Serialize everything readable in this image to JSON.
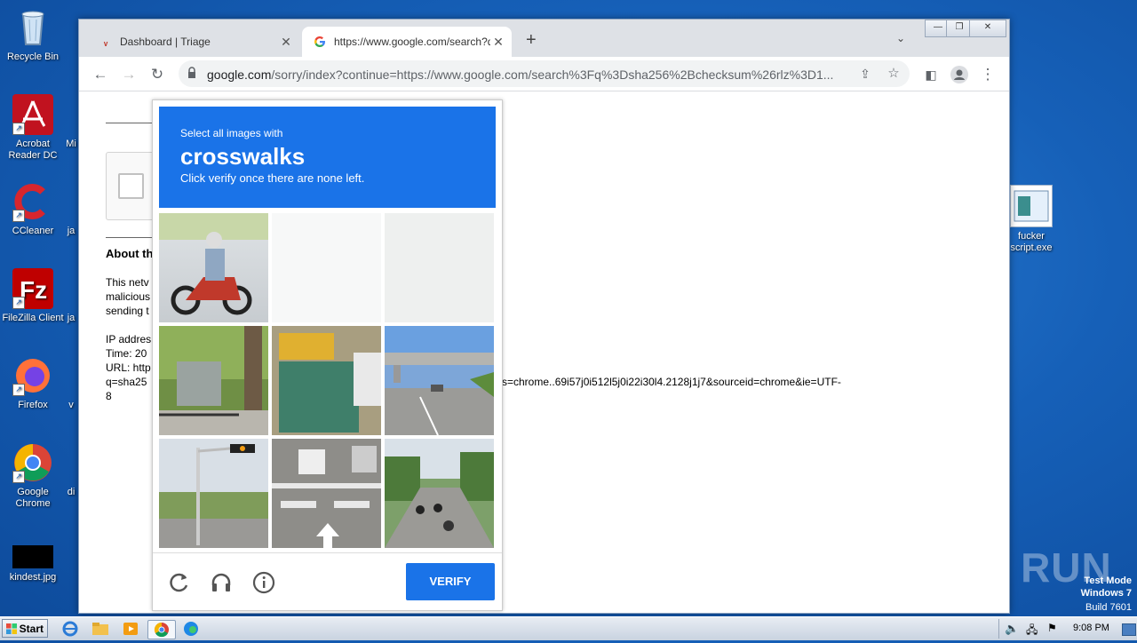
{
  "desktop": {
    "icons": [
      {
        "label": "Recycle Bin"
      },
      {
        "label": "Acrobat Reader DC"
      },
      {
        "label": "CCleaner"
      },
      {
        "label": "FileZilla Client"
      },
      {
        "label": "Firefox"
      },
      {
        "label": "Google Chrome"
      },
      {
        "label": "kindest.jpg"
      },
      {
        "label": "fucker script.exe"
      }
    ],
    "partial_labels": [
      "Mi",
      "ja",
      "ja",
      "v",
      "di"
    ]
  },
  "browser": {
    "tabs": [
      {
        "title": "Dashboard | Triage",
        "icon": "triage-icon",
        "active": false
      },
      {
        "title": "https://www.google.com/search?q=",
        "icon": "google-icon",
        "active": true
      }
    ],
    "url_host": "google.com",
    "url_rest": "/sorry/index?continue=https://www.google.com/search%3Fq%3Dsha256%2Bchecksum%26rlz%3D1..."
  },
  "page": {
    "about_heading": "About th",
    "para1": [
      "This netv",
      "malicious",
      "sending t"
    ],
    "ip_line": "IP addres",
    "time_line": "Time: 20",
    "url_line": "URL: http",
    "q_line_start": "q=sha25",
    "q_line_end": "s=chrome..69i57j0i512l5j0i22i30l4.2128j1j7&sourceid=chrome&ie=UTF-",
    "last_line": "8"
  },
  "captcha": {
    "line1": "Select all images with",
    "keyword": "crosswalks",
    "line3": "Click verify once there are none left.",
    "tiles": [
      {
        "subject": "motorcycle rider",
        "state": "image"
      },
      {
        "subject": "blank",
        "state": "faded"
      },
      {
        "subject": "blank",
        "state": "faded"
      },
      {
        "subject": "trees and fence",
        "state": "image"
      },
      {
        "subject": "street signs",
        "state": "image"
      },
      {
        "subject": "highway overpass",
        "state": "image"
      },
      {
        "subject": "traffic light pole",
        "state": "image"
      },
      {
        "subject": "road with crosswalk markings",
        "state": "image"
      },
      {
        "subject": "motorcyclists on road",
        "state": "image"
      }
    ],
    "verify_label": "VERIFY",
    "footer_icons": [
      "reload-icon",
      "audio-icon",
      "info-icon"
    ]
  },
  "taskbar": {
    "start_label": "Start",
    "clock": "9:08 PM"
  },
  "watermark": {
    "brand": "ANY RUN",
    "mode": "Test Mode",
    "os": "Windows 7",
    "build": "Build 7601"
  }
}
